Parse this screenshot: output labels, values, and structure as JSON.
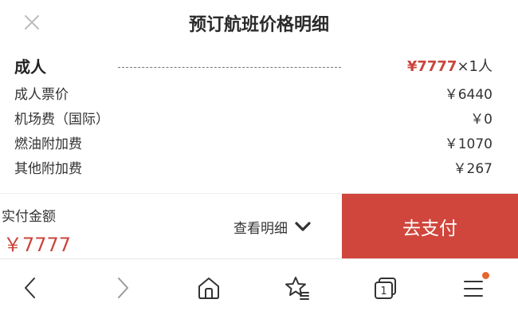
{
  "header": {
    "title": "预订航班价格明细",
    "close_icon": "close-icon"
  },
  "adult": {
    "label": "成人",
    "price": "¥7777",
    "quantity": "×1人"
  },
  "fees": [
    {
      "label": "成人票价",
      "value": "￥6440"
    },
    {
      "label": "机场费（国际）",
      "value": "￥0"
    },
    {
      "label": "燃油附加费",
      "value": "￥1070"
    },
    {
      "label": "其他附加费",
      "value": "￥267"
    }
  ],
  "payment": {
    "label": "实付金额",
    "amount": "￥7777",
    "detail_label": "查看明细",
    "detail_icon": "chevron-down-icon",
    "pay_button": "去支付"
  },
  "nav": {
    "items": [
      "back-icon",
      "forward-icon",
      "home-icon",
      "favorites-icon",
      "tabs-icon",
      "menu-icon"
    ],
    "tabs_count": "1"
  },
  "colors": {
    "accent": "#d0453c",
    "price_red": "#c9463d",
    "notification_dot": "#e8662e"
  }
}
